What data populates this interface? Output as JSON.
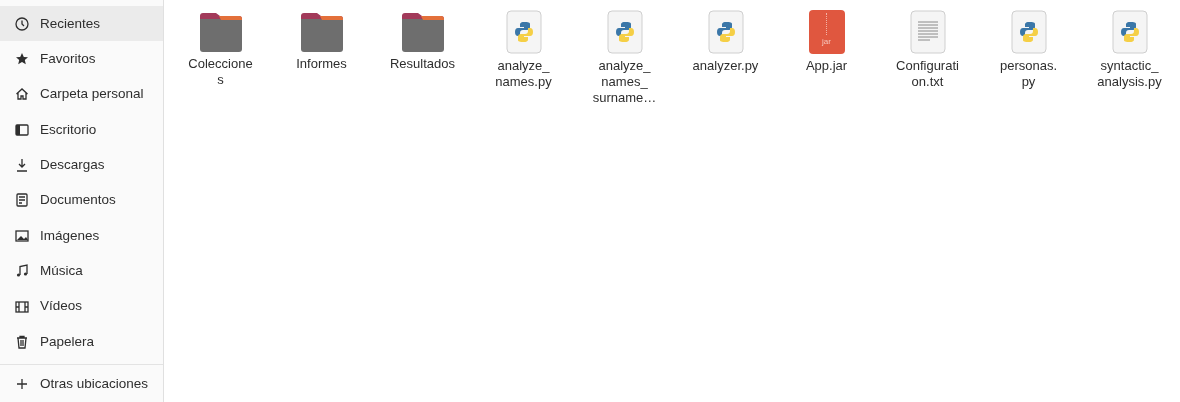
{
  "sidebar": {
    "items": [
      {
        "label": "Recientes",
        "selected": true
      },
      {
        "label": "Favoritos",
        "selected": false
      },
      {
        "label": "Carpeta personal",
        "selected": false
      },
      {
        "label": "Escritorio",
        "selected": false
      },
      {
        "label": "Descargas",
        "selected": false
      },
      {
        "label": "Documentos",
        "selected": false
      },
      {
        "label": "Imágenes",
        "selected": false
      },
      {
        "label": "Música",
        "selected": false
      },
      {
        "label": "Vídeos",
        "selected": false
      },
      {
        "label": "Papelera",
        "selected": false
      }
    ],
    "other": {
      "label": "Otras ubicaciones",
      "selected": false
    }
  },
  "files": [
    {
      "kind": "folder",
      "lines": [
        "Coleccione",
        "s"
      ]
    },
    {
      "kind": "folder",
      "lines": [
        "Informes"
      ]
    },
    {
      "kind": "folder",
      "lines": [
        "Resultados"
      ]
    },
    {
      "kind": "python",
      "lines": [
        "analyze_",
        "names.py"
      ]
    },
    {
      "kind": "python",
      "lines": [
        "analyze_",
        "names_",
        "surname…"
      ]
    },
    {
      "kind": "python",
      "lines": [
        "analyzer.py"
      ]
    },
    {
      "kind": "jar",
      "lines": [
        "App.jar"
      ],
      "badge": "jar"
    },
    {
      "kind": "text",
      "lines": [
        "Configurati",
        "on.txt"
      ]
    },
    {
      "kind": "python",
      "lines": [
        "personas.",
        "py"
      ]
    },
    {
      "kind": "python",
      "lines": [
        "syntactic_",
        "analysis.py"
      ]
    }
  ]
}
